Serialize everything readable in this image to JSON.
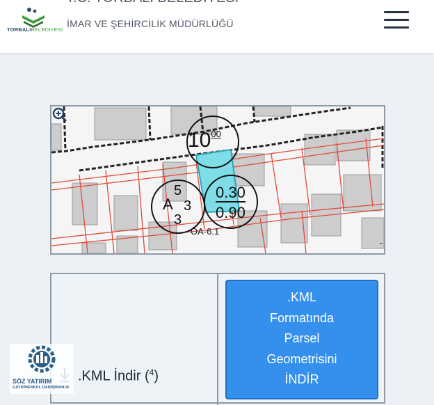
{
  "header": {
    "logo_brand": "TORBALI",
    "logo_suffix": "BELEDİYESİ",
    "title_partial": "T.C. TORBALI BELEDİYESİ",
    "department": "İMAR VE ŞEHİRCİLİK MÜDÜRLÜĞÜ",
    "menu_icon": "hamburger-menu-icon"
  },
  "map": {
    "labels": {
      "block_number": "10",
      "block_superscript": "00",
      "zone_code": "A",
      "floors_top": "5",
      "floors_mid": "3",
      "floors_bottom": "3",
      "ratio_top": "0.30",
      "ratio_bottom": "0.90",
      "plan_code": "ÖA-6.1"
    },
    "zoom_icon": "zoom-in-icon",
    "colors": {
      "parcel_fill": "#7fdde8",
      "boundary": "#e04a3a"
    }
  },
  "download": {
    "kml_button_lines": [
      ".KML",
      "Formatında",
      "Parsel",
      "Geometrisini",
      "İNDİR"
    ],
    "link_label": ".KML İndir (",
    "link_count": "4",
    "link_close": ")",
    "link_icon": "download-icon"
  },
  "watermark": {
    "name": "SÖZ YATIRIM",
    "subtitle": "GAYRİMENKUL DANIŞMANLIK"
  }
}
